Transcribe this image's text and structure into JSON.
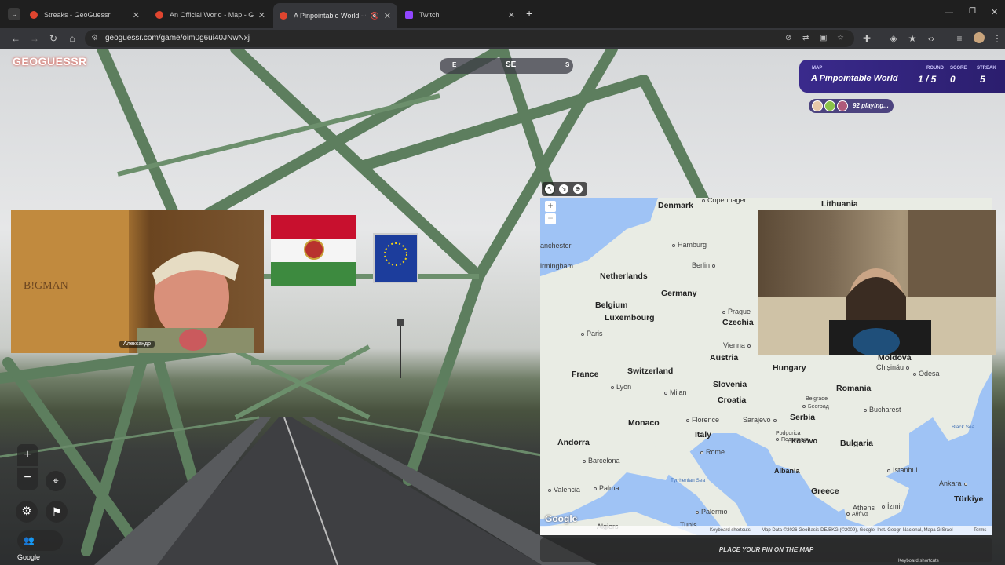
{
  "browser": {
    "tabs": [
      {
        "label": "Streaks - GeoGuessr",
        "color": "#e0452f",
        "active": false
      },
      {
        "label": "An Official World - Map - GeoG",
        "color": "#e0452f",
        "active": false
      },
      {
        "label": "A Pinpointable World - Gam",
        "color": "#e0452f",
        "active": true
      },
      {
        "label": "Twitch",
        "color": "#9146ff",
        "active": false
      }
    ],
    "url": "geoguessr.com/game/oim0g6ui40JNwNxj",
    "new_tab": "+"
  },
  "game": {
    "logo": "GEOGUESSR",
    "compass": {
      "left": "E",
      "center": "SE",
      "right": "S"
    },
    "status": {
      "map_label": "MAP",
      "map_value": "A Pinpointable World",
      "round_label": "ROUND",
      "round_value": "1 / 5",
      "score_label": "SCORE",
      "score_value": "0",
      "streak_label": "STREAK",
      "streak_value": "5"
    },
    "playing": "92 playing...",
    "cam1_label": "Александр",
    "place_pin": "PLACE YOUR PIN ON THE MAP",
    "google_bottom": "Google",
    "keyboard_bottom": "Keyboard shortcuts"
  },
  "map": {
    "countries": [
      {
        "name": "Denmark"
      },
      {
        "name": "Lithuania"
      },
      {
        "name": "Netherlands"
      },
      {
        "name": "Germany"
      },
      {
        "name": "Belgium"
      },
      {
        "name": "Luxembourg"
      },
      {
        "name": "Czechia"
      },
      {
        "name": "Austria"
      },
      {
        "name": "Hungary"
      },
      {
        "name": "Moldova"
      },
      {
        "name": "France"
      },
      {
        "name": "Switzerland"
      },
      {
        "name": "Slovenia"
      },
      {
        "name": "Romania"
      },
      {
        "name": "Croatia"
      },
      {
        "name": "Serbia"
      },
      {
        "name": "Monaco"
      },
      {
        "name": "Italy"
      },
      {
        "name": "Andorra"
      },
      {
        "name": "Kosovo"
      },
      {
        "name": "Bulgaria"
      },
      {
        "name": "Albania"
      },
      {
        "name": "Greece"
      },
      {
        "name": "Türkiye"
      }
    ],
    "cities": [
      "Copenhagen",
      "anchester",
      "Hamburg",
      "irmingham",
      "Berlin",
      "Prague",
      "Paris",
      "Vienna",
      "Chișinău",
      "Odesa",
      "Lyon",
      "Milan",
      "Belgrade",
      "Београд",
      "Bucharest",
      "Florence",
      "Sarajevo",
      "Podgorica",
      "Подгорица",
      "Barcelona",
      "Rome",
      "Valencia",
      "Palma",
      "Istanbul",
      "Ankara",
      "Athens",
      "Αθήνα",
      "İzmir",
      "Palermo",
      "Algiers",
      "Tunis"
    ],
    "seas": [
      "Black Sea",
      "Tyrrhenian Sea"
    ],
    "zoom_in": "+",
    "zoom_out": "−",
    "google_logo": "Google",
    "attribution": {
      "shortcuts": "Keyboard shortcuts",
      "data": "Map Data ©2026 GeoBasis-DE/BKG (©2009), Google, Inst. Geogr. Nacional, Mapa GISrael",
      "terms": "Terms"
    }
  },
  "controls": {
    "zoom_in": "+",
    "zoom_out": "−"
  }
}
